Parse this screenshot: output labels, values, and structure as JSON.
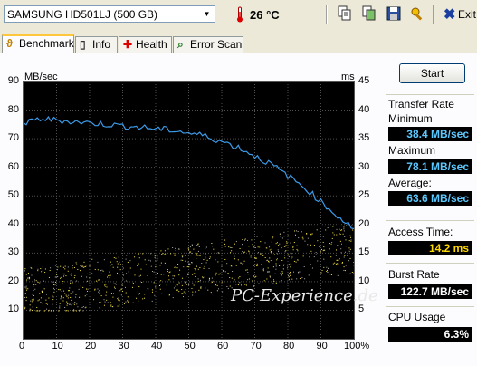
{
  "toolbar": {
    "drive_label": "SAMSUNG HD501LJ (500 GB)",
    "temperature": "26 °C",
    "buttons": [
      "copy-text-icon",
      "copy-screenshot-icon",
      "save-icon",
      "options-icon"
    ],
    "exit_label": "Exit"
  },
  "tabs": [
    {
      "label": "Benchmark",
      "icon": "benchmark-icon",
      "active": true
    },
    {
      "label": "Info",
      "icon": "info-icon",
      "active": false
    },
    {
      "label": "Health",
      "icon": "health-icon",
      "active": false
    },
    {
      "label": "Error Scan",
      "icon": "error-scan-icon",
      "active": false
    }
  ],
  "graph": {
    "left_unit": "MB/sec",
    "right_unit": "ms",
    "left_ticks": [
      "90",
      "80",
      "70",
      "60",
      "50",
      "40",
      "30",
      "20",
      "10"
    ],
    "right_ticks": [
      "45",
      "40",
      "35",
      "30",
      "25",
      "20",
      "15",
      "10",
      "5"
    ],
    "x_ticks": [
      "0",
      "10",
      "20",
      "30",
      "40",
      "50",
      "60",
      "70",
      "80",
      "90",
      "100%"
    ],
    "watermark": "PC-Experience.de"
  },
  "chart_data": {
    "type": "line",
    "xlabel": "",
    "ylabel": "MB/sec",
    "y2label": "ms",
    "xlim": [
      0,
      100
    ],
    "ylim": [
      0,
      90
    ],
    "y2lim": [
      0,
      45
    ],
    "grid": true,
    "series": [
      {
        "axis": "left",
        "color": "#3d9be9",
        "x": [
          0,
          5,
          10,
          15,
          20,
          25,
          30,
          35,
          40,
          45,
          50,
          55,
          60,
          65,
          70,
          75,
          80,
          85,
          90,
          95,
          100
        ],
        "y": [
          75,
          77,
          76.5,
          76,
          75.5,
          75,
          74.5,
          74,
          73.5,
          73,
          72,
          71,
          69,
          67,
          64,
          61,
          57,
          53,
          48,
          43,
          38.5
        ]
      },
      {
        "kind": "scatter",
        "axis": "right",
        "color": "#ffe840",
        "x_range": [
          0,
          100
        ],
        "y_range": [
          5,
          20
        ]
      }
    ]
  },
  "panel": {
    "start_label": "Start",
    "transfer_rate_title": "Transfer Rate",
    "minimum_label": "Minimum",
    "minimum_value": "38.4 MB/sec",
    "maximum_label": "Maximum",
    "maximum_value": "78.1 MB/sec",
    "average_label": "Average:",
    "average_value": "63.6 MB/sec",
    "access_label": "Access Time:",
    "access_value": "14.2 ms",
    "burst_label": "Burst Rate",
    "burst_value": "122.7 MB/sec",
    "cpu_label": "CPU Usage",
    "cpu_value": "6.3%"
  },
  "colors": {
    "graph_bg": "#000000",
    "grid": "#505050",
    "transfer_line": "#3d9be9",
    "access_points": "#ffe840",
    "value_blue": "#5bc9ff",
    "value_yellow": "#ffd800"
  }
}
